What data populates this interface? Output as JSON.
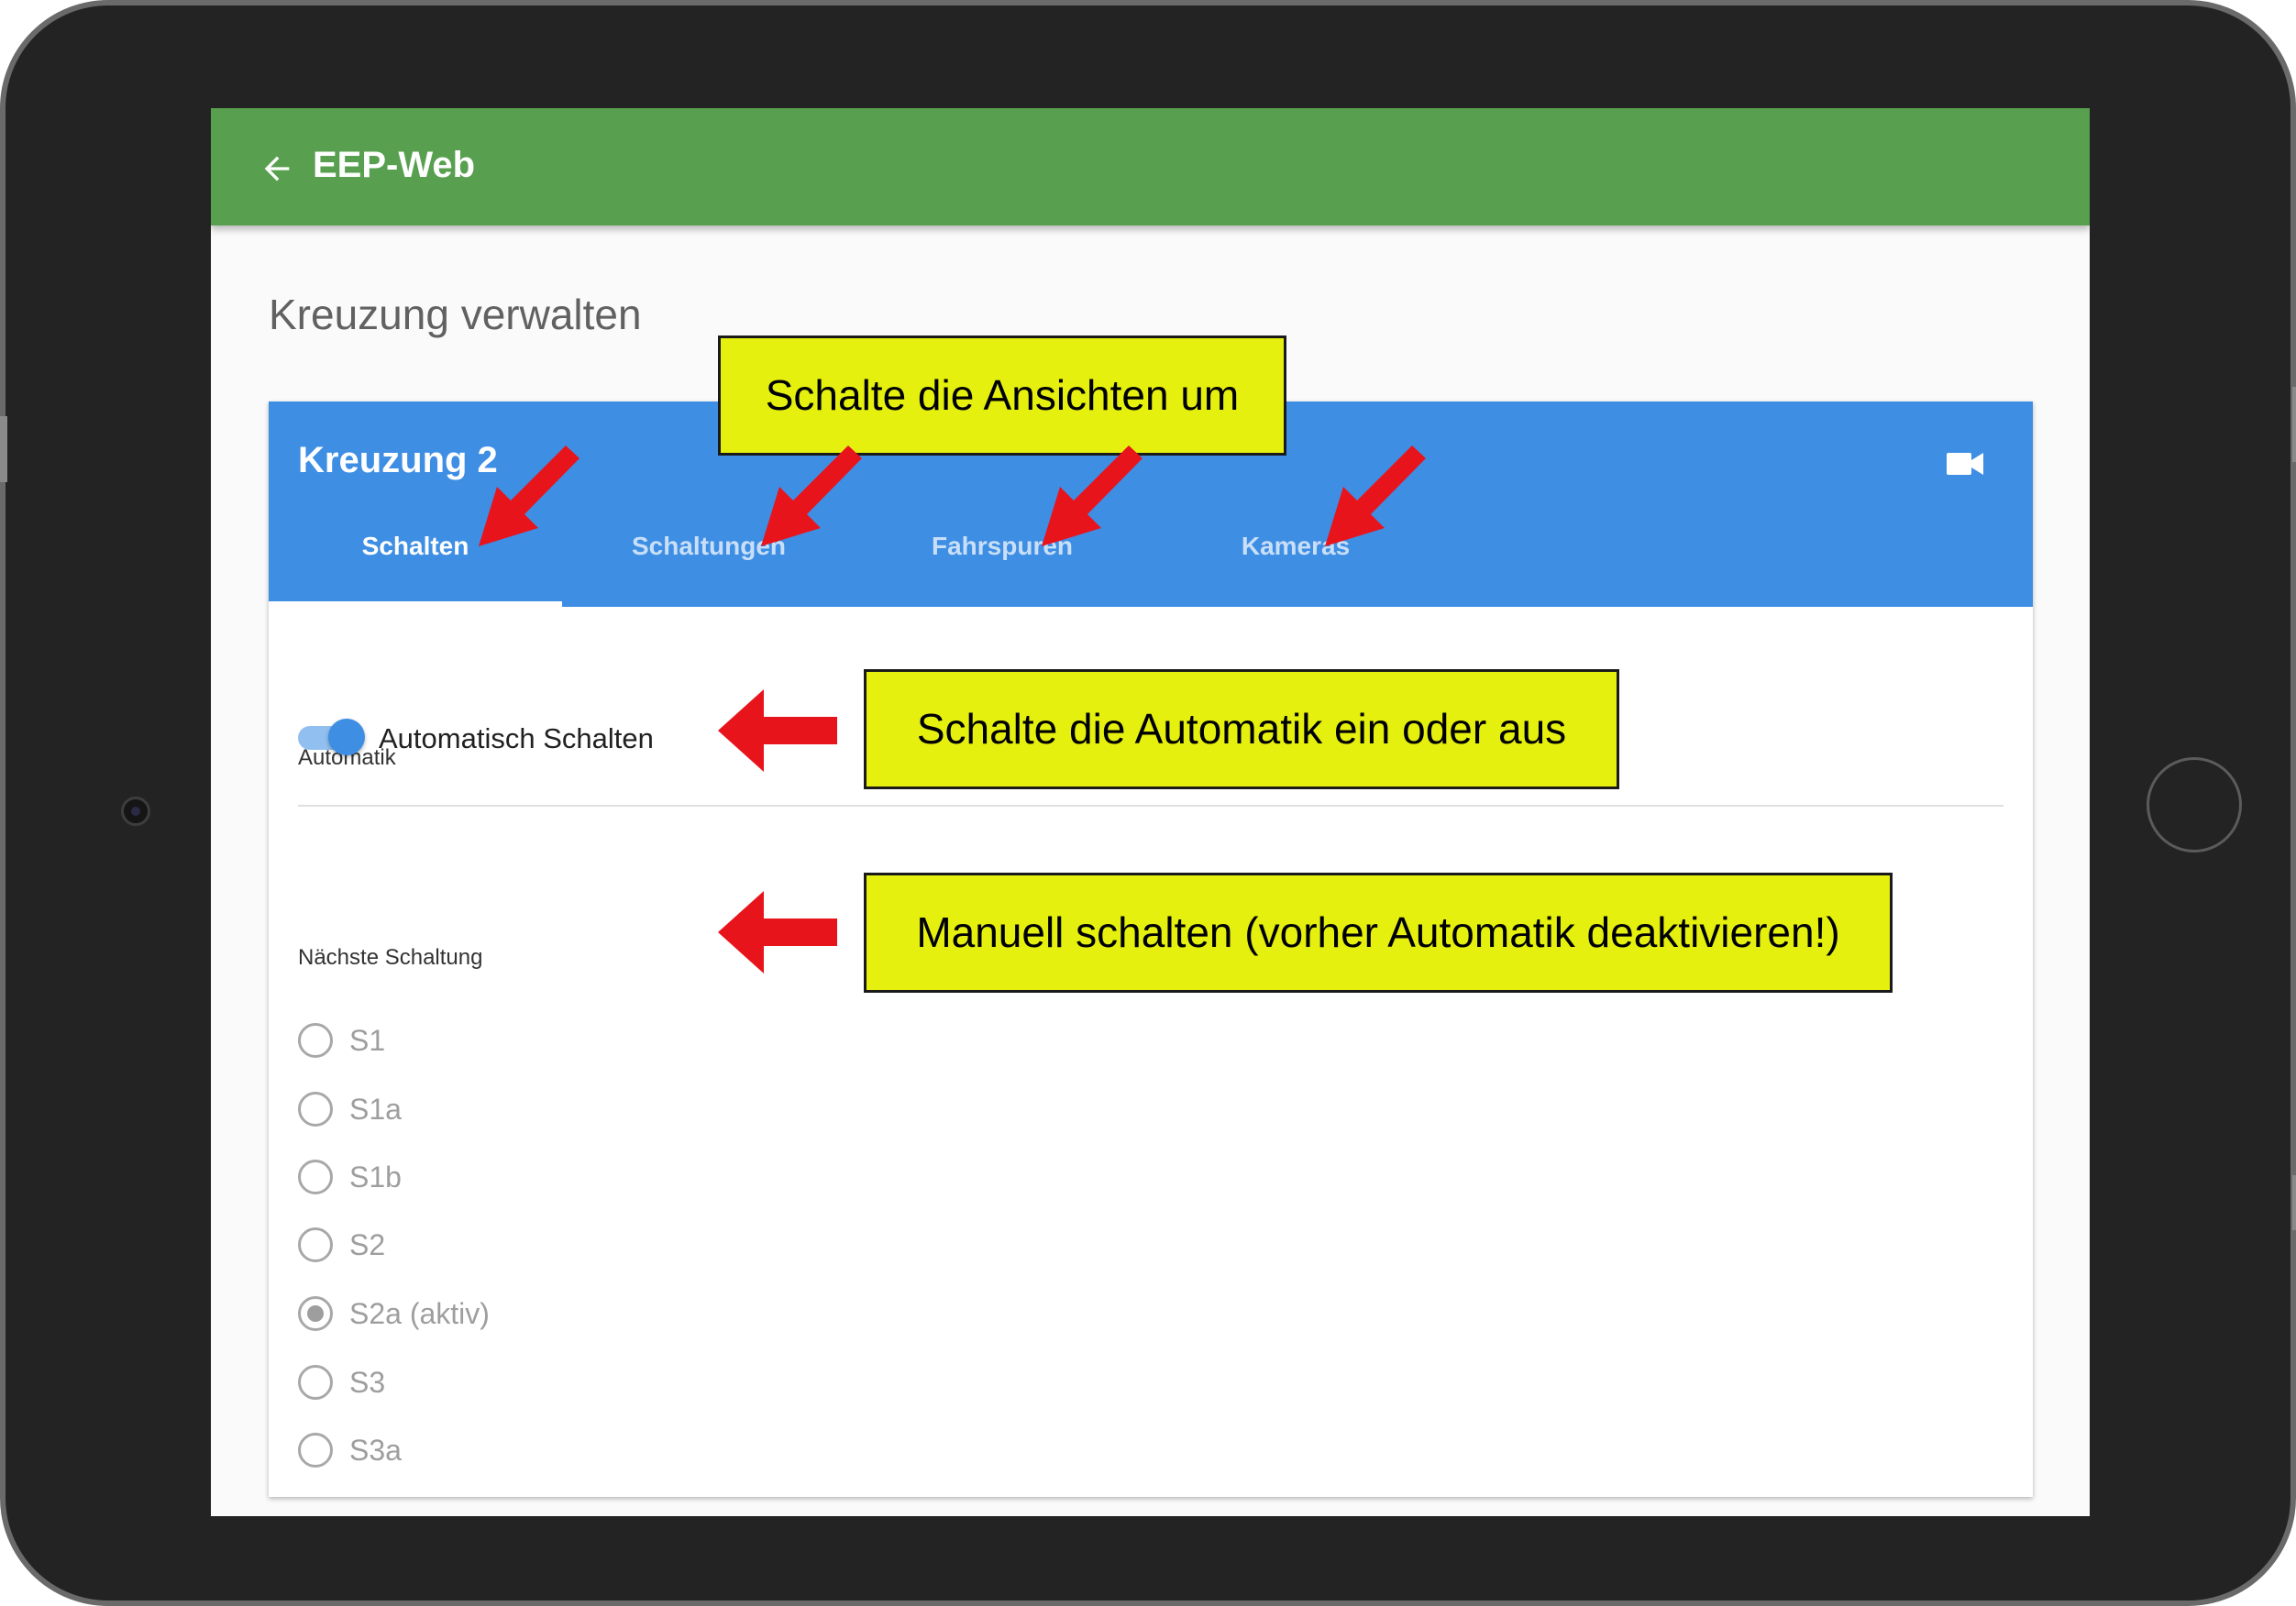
{
  "app": {
    "title": "EEP-Web",
    "back_icon": "arrow-left-icon",
    "colors": {
      "appbar": "#58a04f",
      "card_header": "#3e8ee4",
      "callout": "#e5f00f",
      "arrow": "#e8141b"
    }
  },
  "page": {
    "title": "Kreuzung verwalten"
  },
  "card": {
    "title": "Kreuzung 2",
    "header_icon": "videocam-icon",
    "tabs": [
      {
        "label": "Schalten",
        "active": true
      },
      {
        "label": "Schaltungen",
        "active": false
      },
      {
        "label": "Fahrspuren",
        "active": false
      },
      {
        "label": "Kameras",
        "active": false
      }
    ]
  },
  "automatic": {
    "section_label": "Automatik",
    "toggle_label": "Automatisch Schalten",
    "enabled": true
  },
  "next_switch": {
    "section_label": "Nächste Schaltung",
    "options": [
      {
        "label": "S1",
        "checked": false
      },
      {
        "label": "S1a",
        "checked": false
      },
      {
        "label": "S1b",
        "checked": false
      },
      {
        "label": "S2",
        "checked": false
      },
      {
        "label": "S2a (aktiv)",
        "checked": true
      },
      {
        "label": "S3",
        "checked": false
      },
      {
        "label": "S3a",
        "checked": false
      }
    ]
  },
  "annotations": {
    "tabs_hint": "Schalte die Ansichten um",
    "automatic_hint": "Schalte die Automatik ein oder aus",
    "manual_hint": "Manuell schalten (vorher Automatik deaktivieren!)"
  }
}
